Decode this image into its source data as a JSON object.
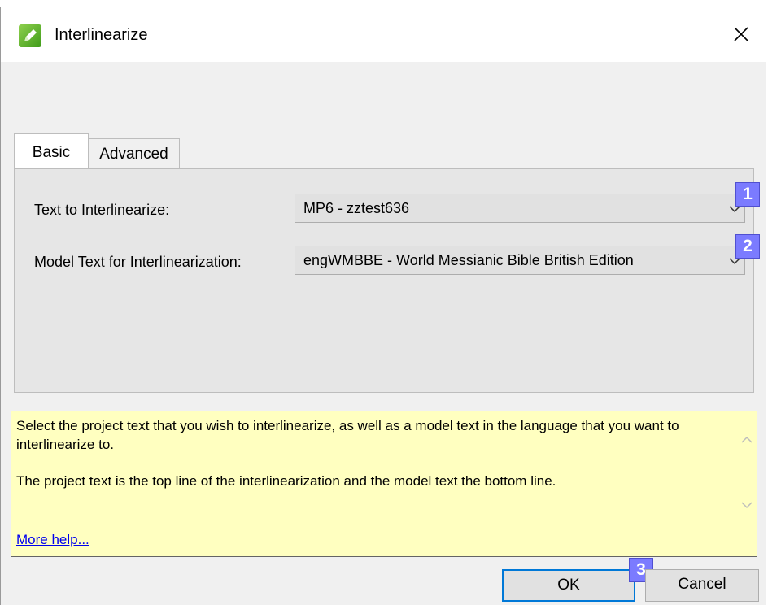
{
  "window": {
    "title": "Interlinearize",
    "close_glyph": "✕",
    "icon": "green-pencil-icon"
  },
  "tabs": [
    {
      "label": "Basic",
      "active": true
    },
    {
      "label": "Advanced",
      "active": false
    }
  ],
  "fields": {
    "text_label": "Text to Interlinearize:",
    "text_value": "MP6 -  zztest636",
    "model_label": "Model Text for Interlinearization:",
    "model_value": "engWMBBE -  World Messianic Bible British Edition"
  },
  "badges": [
    "1",
    "2",
    "3"
  ],
  "help": {
    "paragraph1": "Select the project text that you wish to interlinearize, as well as a model text in the language that you want to interlinearize to.",
    "paragraph2": "The project text is the top line of the interlinearization and the model text the bottom line.",
    "link": "More help..."
  },
  "buttons": {
    "ok": "OK",
    "cancel": "Cancel"
  },
  "colors": {
    "badge": "#7b7bff",
    "help_background": "#ffffc0",
    "ok_border": "#0078d7"
  }
}
